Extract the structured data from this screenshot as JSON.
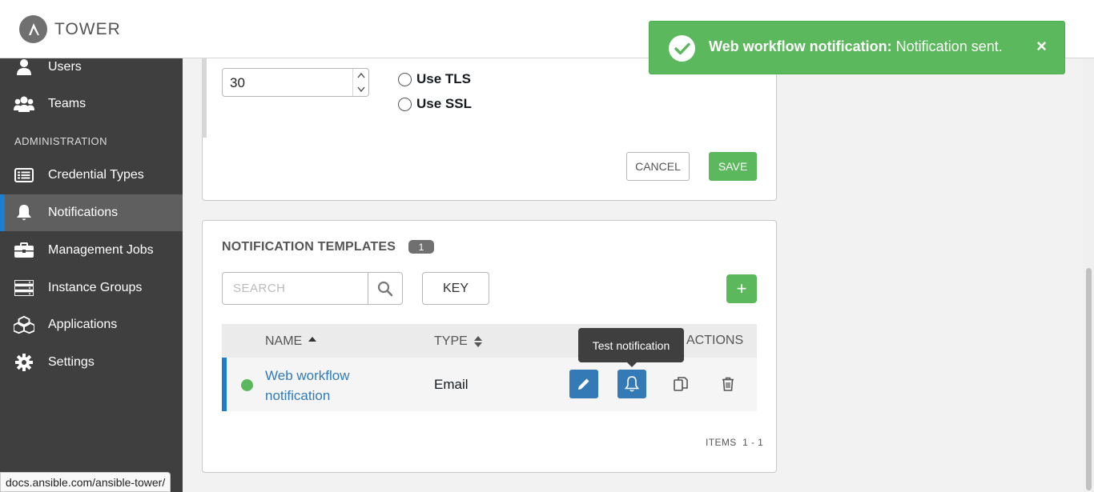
{
  "app": {
    "brand": "TOWER"
  },
  "sidebar": {
    "items": [
      {
        "label": "Users",
        "icon": "user-icon"
      },
      {
        "label": "Teams",
        "icon": "users-icon"
      },
      {
        "label": "Credential Types",
        "icon": "list-alt-icon"
      },
      {
        "label": "Notifications",
        "icon": "bell-icon",
        "active": true
      },
      {
        "label": "Management Jobs",
        "icon": "briefcase-icon"
      },
      {
        "label": "Instance Groups",
        "icon": "server-icon"
      },
      {
        "label": "Applications",
        "icon": "cubes-icon"
      },
      {
        "label": "Settings",
        "icon": "gear-icon"
      }
    ],
    "section_heading": "ADMINISTRATION"
  },
  "form": {
    "timeout_value": "30",
    "use_tls_label": "Use TLS",
    "use_ssl_label": "Use SSL",
    "cancel_label": "CANCEL",
    "save_label": "SAVE"
  },
  "templates": {
    "title": "NOTIFICATION TEMPLATES",
    "count": "1",
    "search_placeholder": "SEARCH",
    "key_label": "KEY",
    "add_label": "+",
    "columns": {
      "name": "NAME",
      "type": "TYPE",
      "actions": "ACTIONS"
    },
    "rows": [
      {
        "name": "Web workflow notification",
        "type": "Email",
        "status_color": "#5cb85c"
      }
    ],
    "tooltip": "Test notification",
    "items_label": "ITEMS",
    "items_range": "1 - 1"
  },
  "toast": {
    "title": "Web workflow notification:",
    "message": "Notification sent.",
    "close": "×"
  },
  "statusbar": {
    "url": "docs.ansible.com/ansible-tower/"
  },
  "colors": {
    "accent": "#1d7ed0",
    "success": "#5cb85c",
    "link": "#337ab7",
    "sidebar": "#3f3f3f"
  }
}
